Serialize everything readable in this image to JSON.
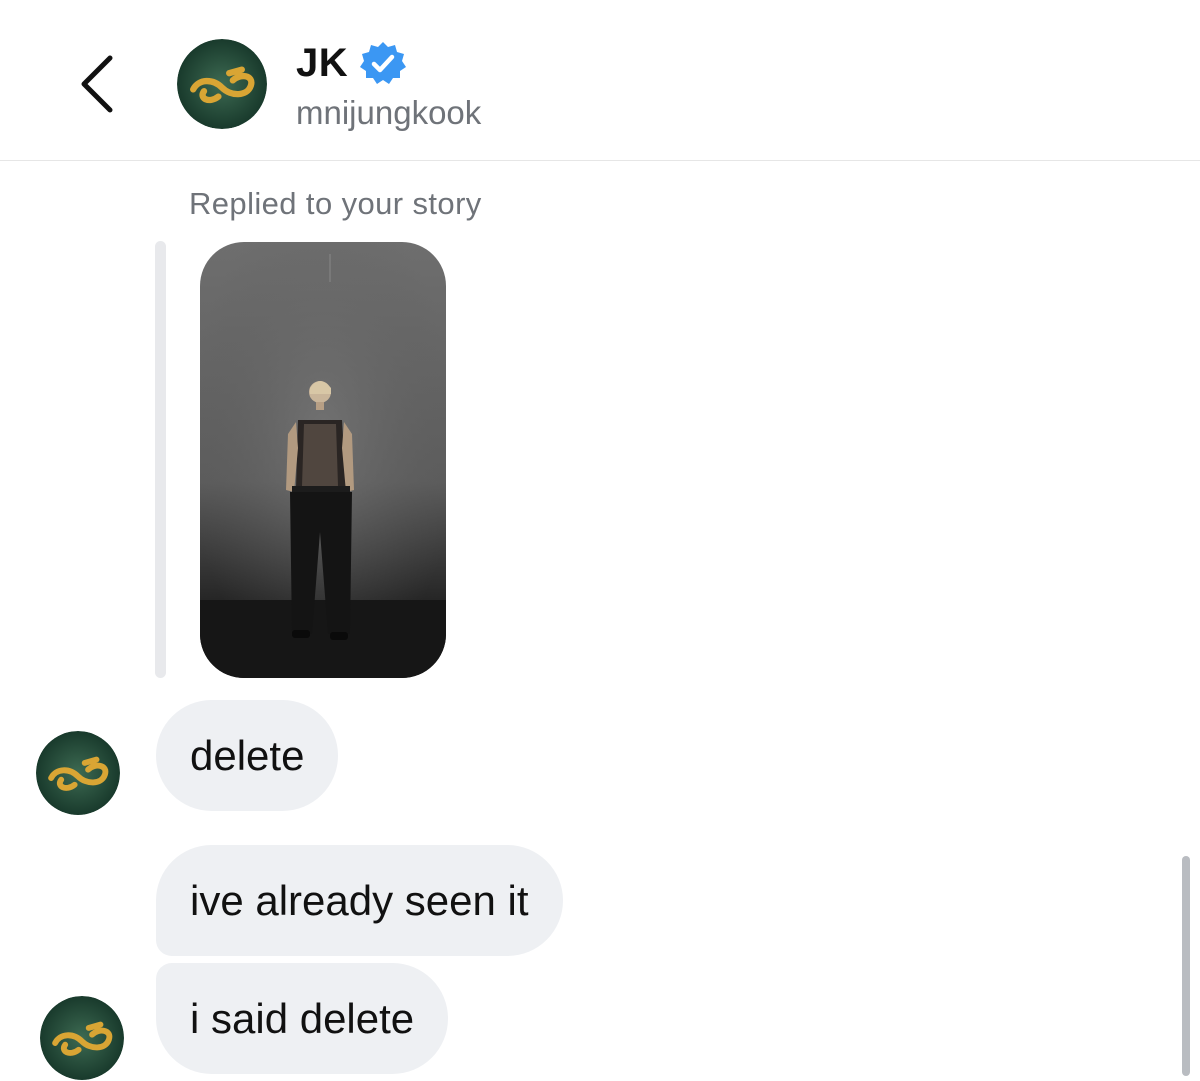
{
  "header": {
    "display_name": "JK",
    "username": "mnijungkook",
    "verified": true,
    "back_icon": "chevron-left-icon",
    "verified_icon": "verified-badge-icon"
  },
  "story_reply": {
    "caption": "Replied to your story"
  },
  "messages": [
    {
      "text": "delete",
      "sender": "other"
    },
    {
      "text": "ive already seen it",
      "sender": "other"
    },
    {
      "text": "i said delete",
      "sender": "other"
    }
  ],
  "colors": {
    "bubble": "#eef0f3",
    "verified": "#3b97f3",
    "muted_text": "#6f7379",
    "avatar_bg": "#1f4a3c",
    "avatar_logo": "#d9a534"
  }
}
